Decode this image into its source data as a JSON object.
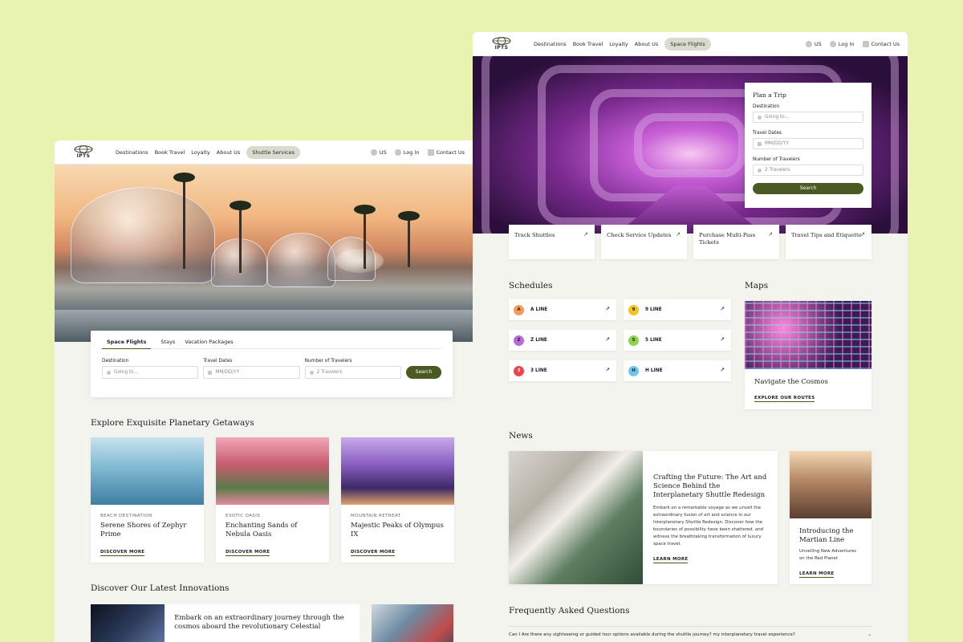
{
  "nav": {
    "logo_text": "IPTS",
    "links": [
      "Destinations",
      "Book Travel",
      "Loyalty",
      "About Us"
    ],
    "left_active": "Shuttle Services",
    "right_active": "Space Flights",
    "region": "US",
    "login": "Log In",
    "contact": "Contact Us"
  },
  "left": {
    "tabs": [
      "Space Flights",
      "Stays",
      "Vacation Packages"
    ],
    "destination_label": "Destination",
    "destination_placeholder": "Going to...",
    "dates_label": "Travel Dates",
    "dates_placeholder": "MM/DD/YY",
    "travelers_label": "Number of Travelers",
    "travelers_placeholder": "2 Travelers",
    "search": "Search",
    "getaways_title": "Explore Exquisite Planetary Getaways",
    "cards": [
      {
        "kicker": "BEACH DESTINATION",
        "title": "Serene Shores of Zephyr Prime",
        "link": "DISCOVER MORE"
      },
      {
        "kicker": "EXOTIC OASIS",
        "title": "Enchanting Sands of Nebula Oasis",
        "link": "DISCOVER MORE"
      },
      {
        "kicker": "MOUNTAIN RETREAT",
        "title": "Majestic Peaks of Olympus IX",
        "link": "DISCOVER MORE"
      }
    ],
    "innovations_title": "Discover Our Latest Innovations",
    "innovation_text": "Embark on an extraordinary journey through the cosmos aboard the revolutionary Celestial"
  },
  "right": {
    "plan": {
      "title": "Plan a Trip",
      "destination_label": "Destination",
      "destination_placeholder": "Going to...",
      "dates_label": "Travel Dates",
      "dates_placeholder": "MM/DD/YY",
      "travelers_label": "Number of Travelers",
      "travelers_placeholder": "2 Travelers",
      "search": "Search"
    },
    "quick": [
      "Track Shuttles",
      "Check Service Updates",
      "Purchase Multi-Pass Tickets",
      "Travel Tips and Etiquette"
    ],
    "schedules_title": "Schedules",
    "lines": [
      {
        "badge": "A",
        "label": "A LINE",
        "color": "#f59a5b"
      },
      {
        "badge": "9",
        "label": "9 LINE",
        "color": "#f2c41d"
      },
      {
        "badge": "Z",
        "label": "Z LINE",
        "color": "#b96ad8"
      },
      {
        "badge": "5",
        "label": "5 LINE",
        "color": "#8cd44a"
      },
      {
        "badge": "3",
        "label": "3 LINE",
        "color": "#f0444f"
      },
      {
        "badge": "H",
        "label": "H LINE",
        "color": "#6ac7ef"
      }
    ],
    "maps_title": "Maps",
    "map_card_title": "Navigate the Cosmos",
    "map_card_link": "EXPLORE OUR ROUTES",
    "news_title": "News",
    "news_main": {
      "title": "Crafting the Future: The Art and Science Behind the Interplanetary Shuttle Redesign",
      "text": "Embark on a remarkable voyage as we unveil the extraordinary fusion of art and science in our Interplanetary Shuttle Redesign. Discover how the boundaries of possibility have been shattered, and witness the breathtaking transformation of luxury space travel.",
      "link": "LEARN MORE"
    },
    "news_side": {
      "title": "Introducing the Martian Line",
      "text": "Unveiling New Adventures on the Red Planet",
      "link": "LEARN MORE"
    },
    "faq_title": "Frequently Asked Questions",
    "faq_question": "Can I Are there any sightseeing or guided tour options available during the shuttle journey? my interplanetary travel experience?"
  }
}
